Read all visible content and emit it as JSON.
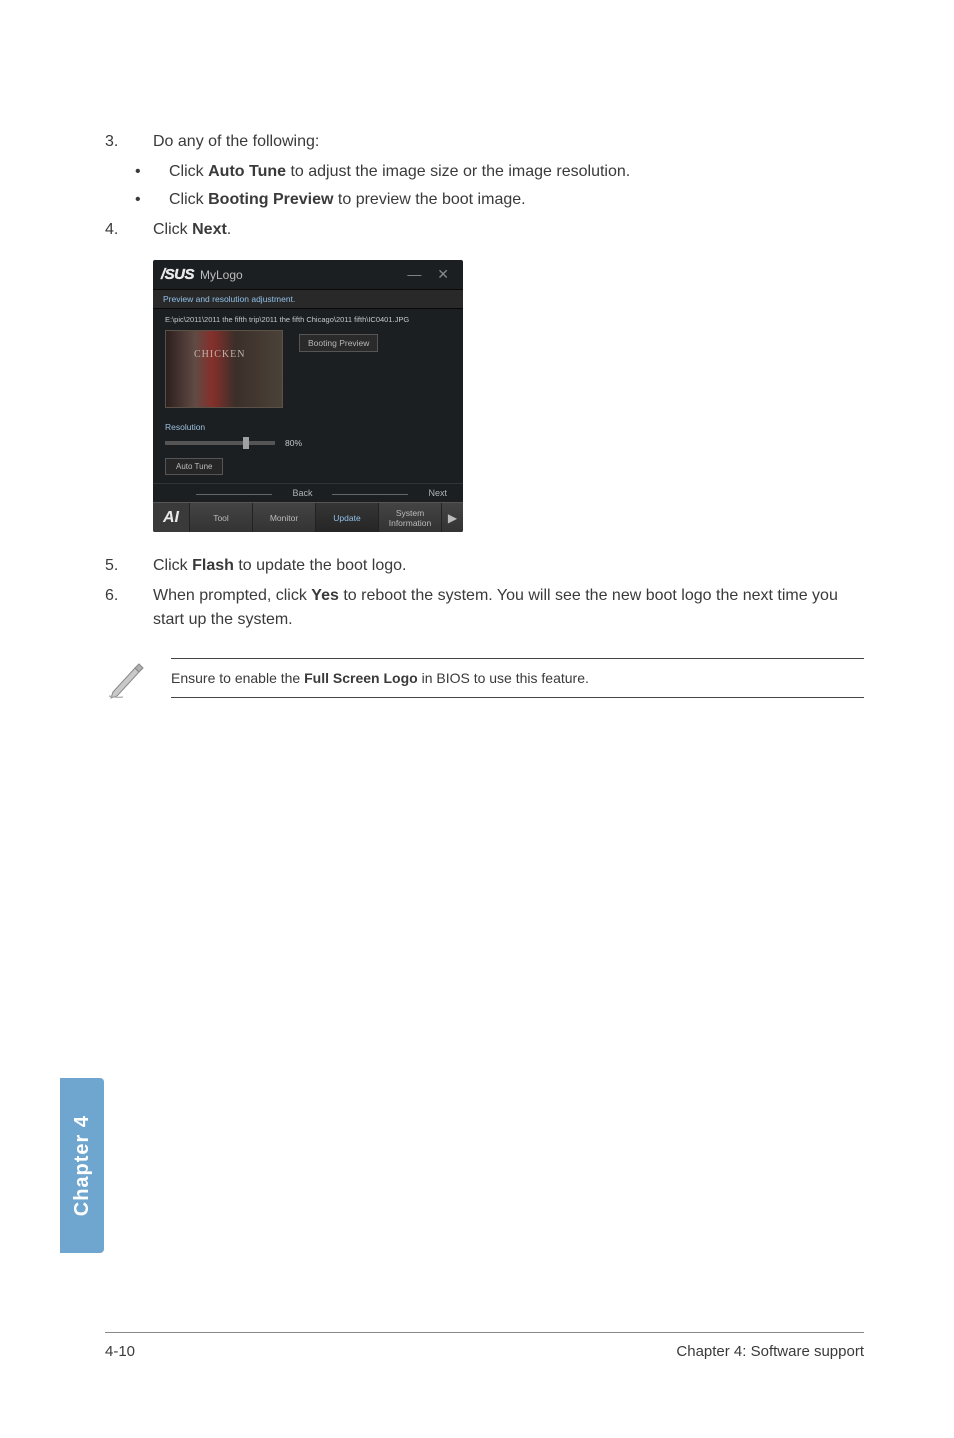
{
  "steps": {
    "s3": {
      "num": "3.",
      "text": "Do any of the following:"
    },
    "bul1_pre": "Click ",
    "bul1_bold": "Auto Tune",
    "bul1_post": " to adjust the image size or the image resolution.",
    "bul2_pre": "Click ",
    "bul2_bold": "Booting Preview",
    "bul2_post": " to preview the boot image.",
    "s4": {
      "num": "4.",
      "pre": "Click ",
      "bold": "Next",
      "post": "."
    },
    "s5": {
      "num": "5.",
      "pre": "Click ",
      "bold": "Flash",
      "post": " to update the boot logo."
    },
    "s6": {
      "num": "6.",
      "pre": "When prompted, click ",
      "bold": "Yes",
      "post": " to reboot the system. You will see the new boot logo the next time you start up the system."
    }
  },
  "screenshot": {
    "brand": "/SUS",
    "app": "MyLogo",
    "close": "— ✕",
    "header_sub": "Preview and resolution adjustment.",
    "path": "E:\\pic\\2011\\2011 the fifth trip\\2011 the fifth Chicago\\2011 fifth\\IC0401.JPG",
    "booting_preview": "Booting Preview",
    "resolution_label": "Resolution",
    "slider_value": "80%",
    "auto_tune": "Auto Tune",
    "back": "Back",
    "next": "Next",
    "ai": "AI",
    "tab_tool": "Tool",
    "tab_monitor": "Monitor",
    "tab_update": "Update",
    "tab_sysinfo": "System Information",
    "arrow": "▶"
  },
  "note": {
    "pre": "Ensure to enable the ",
    "bold": "Full Screen Logo",
    "post": " in BIOS to use this feature."
  },
  "sidetab": "Chapter 4",
  "footer": {
    "left": "4-10",
    "right": "Chapter 4: Software support"
  }
}
